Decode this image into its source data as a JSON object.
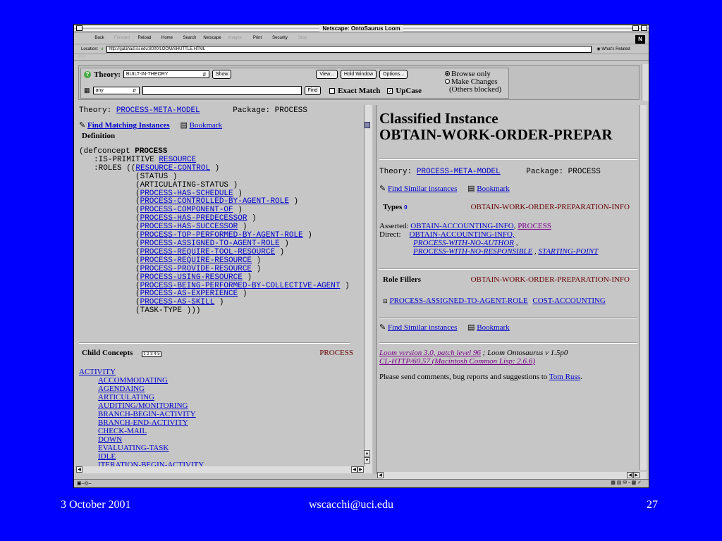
{
  "window": {
    "title": "Netscape: OntoSaurus Loom"
  },
  "toolbar": {
    "buttons": [
      {
        "label": "Back",
        "enabled": true
      },
      {
        "label": "Forward",
        "enabled": false
      },
      {
        "label": "Reload",
        "enabled": true
      },
      {
        "label": "Home",
        "enabled": true
      },
      {
        "label": "Search",
        "enabled": true
      },
      {
        "label": "Netscape",
        "enabled": true
      },
      {
        "label": "Images",
        "enabled": false
      },
      {
        "label": "Print",
        "enabled": true
      },
      {
        "label": "Security",
        "enabled": true
      },
      {
        "label": "Stop",
        "enabled": false
      }
    ]
  },
  "location": {
    "label": "Location:",
    "url": "http://galahad.isi.edu:8000/LOOM/SHUTTLE.HTML",
    "related": "What's Related"
  },
  "controls": {
    "theory_label": "Theory:",
    "theory_value": "BUILT-IN-THEORY",
    "show": "Show",
    "view": "View...",
    "hold": "Hold Window",
    "options": "Options...",
    "any": "any",
    "find": "Find",
    "exact": "Exact Match",
    "upcase": "UpCase",
    "browse": "Browse only",
    "make": "Make Changes",
    "others": "(Others blocked)"
  },
  "left": {
    "theory_label": "Theory:",
    "theory_link": "PROCESS-META-MODEL",
    "package": "Package: PROCESS",
    "find_matching": "Find Matching Instances",
    "bookmark": "Bookmark",
    "definition": "Definition",
    "def_open": "(defconcept ",
    "def_name": "PROCESS",
    "is_primitive": ":IS-PRIMITIVE ",
    "resource": "RESOURCE",
    "roles": ":ROLES ((",
    "roles_first": "RESOURCE-CONTROL",
    "role_lines": [
      {
        "text": "(STATUS )",
        "link": false
      },
      {
        "text": "(ARTICULATING-STATUS )",
        "link": false
      },
      {
        "text": "PROCESS-HAS-SCHEDULE",
        "link": true
      },
      {
        "text": "PROCESS-CONTROLLED-BY-AGENT-ROLE",
        "link": true
      },
      {
        "text": "PROCESS-COMPONENT-OF",
        "link": true
      },
      {
        "text": "PROCESS-HAS-PREDECESSOR",
        "link": true
      },
      {
        "text": "PROCESS-HAS-SUCCESSOR",
        "link": true
      },
      {
        "text": "PROCESS-TOP-PERFORMED-BY-AGENT-ROLE",
        "link": true
      },
      {
        "text": "PROCESS-ASSIGNED-TO-AGENT-ROLE",
        "link": true
      },
      {
        "text": "PROCESS-REQUIRE-TOOL-RESOURCE",
        "link": true
      },
      {
        "text": "PROCESS-REQUIRE-RESOURCE",
        "link": true
      },
      {
        "text": "PROCESS-PROVIDE-RESOURCE",
        "link": true
      },
      {
        "text": "PROCESS-USING-RESOURCE",
        "link": true
      },
      {
        "text": "PROCESS-BEING-PERFORMED-BY-COLLECTIVE-AGENT",
        "link": true
      },
      {
        "text": "PROCESS-AS-EXPERIENCE",
        "link": true
      },
      {
        "text": "PROCESS-AS-SKILL",
        "link": true
      },
      {
        "text": "(TASK-TYPE )))",
        "link": false
      }
    ],
    "child_concepts": "Child Concepts",
    "child_badge": "1 2 3 4 5",
    "child_process": "PROCESS",
    "activity": "ACTIVITY",
    "children": [
      "ACCOMMODATING",
      "AGENDAING",
      "ARTICULATING",
      "AUDITING/MONITORING",
      "BRANCH-BEGIN-ACTIVITY",
      "BRANCH-END-ACTIVITY",
      "CHECK-MAIL",
      "DOWN",
      "EVALUATING-TASK",
      "IDLE",
      "ITERATION-BEGIN-ACTIVITY"
    ]
  },
  "right": {
    "heading1": "Classified Instance",
    "heading2": "OBTAIN-WORK-ORDER-PREPAR",
    "theory_label": "Theory:",
    "theory_link": "PROCESS-META-MODEL",
    "package": "Package: PROCESS",
    "find_similar": "Find Similar instances",
    "bookmark": "Bookmark",
    "types": "Types",
    "types_badge": "0",
    "instance_name": "OBTAIN-WORK-ORDER-PREPARATION-INFO",
    "asserted_label": "Asserted:",
    "asserted1": "OBTAIN-ACCOUNTING-INFO",
    "asserted2": "PROCESS",
    "direct_label": "Direct:",
    "direct1": "OBTAIN-ACCOUNTING-INFO,",
    "direct2": "PROCESS-WITH-NO-AUTHOR",
    "direct3": "PROCESS-WITH-NO-RESPONSIBLE",
    "direct4": "STARTING-POINT",
    "role_fillers": "Role Fillers",
    "role_instance": "OBTAIN-WORK-ORDER-PREPARATION-INFO",
    "role1": "PROCESS-ASSIGNED-TO-AGENT-ROLE",
    "role2": "COST-ACCOUNTING",
    "find_similar2": "Find Similar instances",
    "bookmark2": "Bookmark",
    "version": "Loom version 3.0, patch level 96",
    "version_suffix": "; Loom Ontosaurus v 1.5p0",
    "clhttp": "CL-HTTP/60.57 (Macintosh Common Lisp: 2.6.6)",
    "comments": "Please send comments, bug reports and suggestions to ",
    "author": "Tom Russ",
    "period": "."
  },
  "slide_footer": {
    "date": "3 October 2001",
    "email": "wscacchi@uci.edu",
    "page": "27"
  }
}
